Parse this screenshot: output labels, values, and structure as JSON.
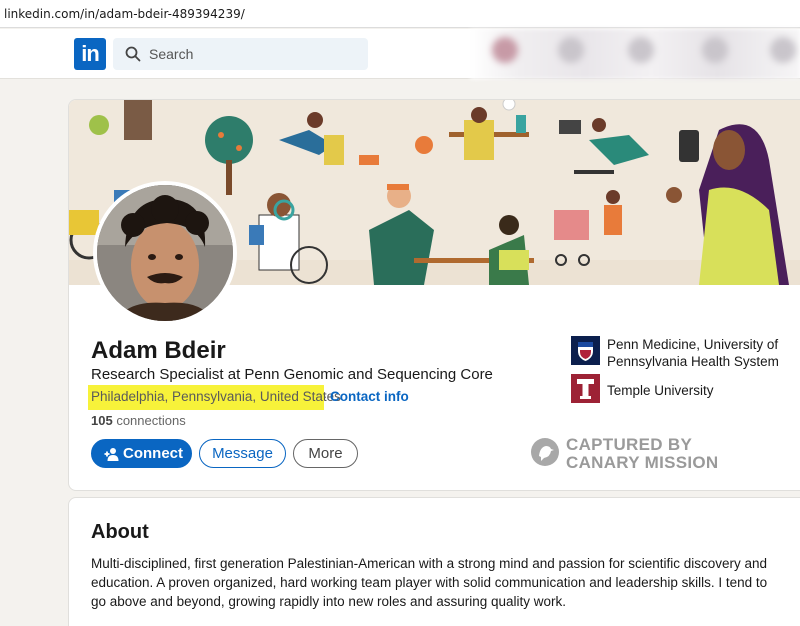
{
  "browser": {
    "url": "linkedin.com/in/adam-bdeir-489394239/"
  },
  "nav": {
    "logo_text": "in",
    "search_placeholder": "Search",
    "search_icon": "search-icon"
  },
  "profile": {
    "name": "Adam Bdeir",
    "headline": "Research Specialist at Penn Genomic and Sequencing Core",
    "location": "Philadelphia, Pennsylvania, United States",
    "separator": "·",
    "contact_label": "Contact info",
    "connections_count": "105",
    "connections_label": "connections",
    "highlight_color": "#f7f23a"
  },
  "actions": {
    "connect_label": "Connect",
    "message_label": "Message",
    "more_label": "More"
  },
  "organizations": [
    {
      "name": "Penn Medicine, University of Pennsylvania Health System",
      "logo": "penn-shield-icon"
    },
    {
      "name": "Temple University",
      "logo": "temple-t-icon"
    }
  ],
  "watermark": {
    "line1": "CAPTURED BY",
    "line2": "CANARY MISSION"
  },
  "about": {
    "title": "About",
    "text": "Multi-disciplined, first generation Palestinian-American with a strong mind and passion for scientific discovery and education. A proven organized, hard working team player with solid communication and leadership skills. I tend to go above and beyond, growing rapidly into new roles and assuring quality work."
  },
  "colors": {
    "brand": "#0a66c2",
    "background": "#f4f2ee",
    "penn": "#0b1f4d",
    "temple": "#9d2235"
  }
}
